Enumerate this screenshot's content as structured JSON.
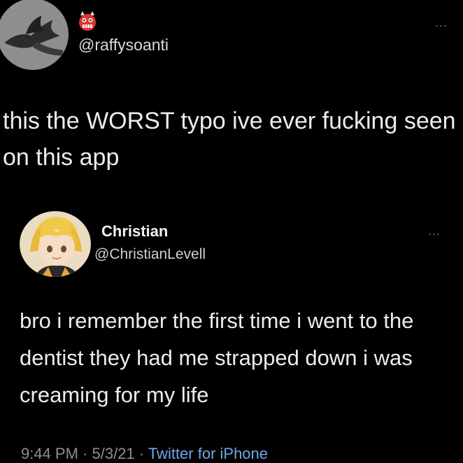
{
  "top_tweet": {
    "handle": "@raffysoanti",
    "emoji": "demon-emoji",
    "text": "this the WORST typo ive ever fucking seen on this app",
    "more": "..."
  },
  "quoted_tweet": {
    "name": "Christian",
    "handle": "@ChristianLevell",
    "text": "bro i remember the first time i went to the dentist they had me strapped down i was creaming for my life",
    "more": "...",
    "meta": {
      "time": "9:44 PM",
      "sep1": " · ",
      "date": "5/3/21",
      "sep2": " · ",
      "source": "Twitter for iPhone"
    }
  },
  "colors": {
    "background": "#000000",
    "text": "#ececec",
    "muted": "#8b8f93",
    "link": "#6ea8e6",
    "emoji_red": "#e0332f"
  }
}
